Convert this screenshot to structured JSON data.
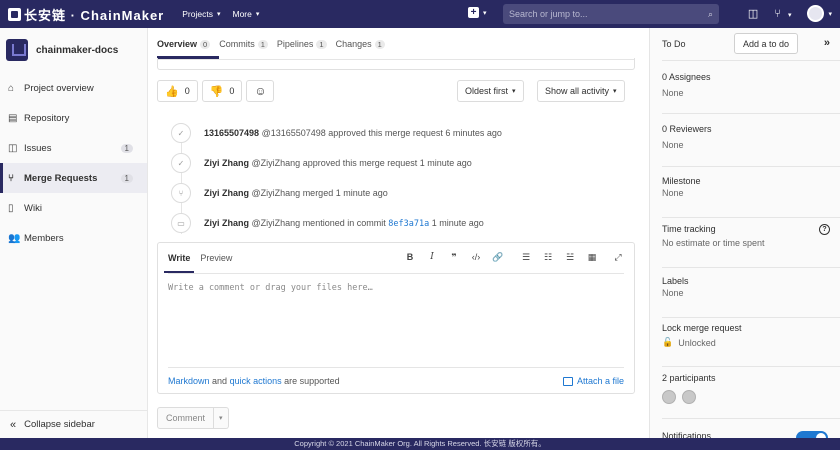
{
  "topbar": {
    "logo_text": "长安链 · ChainMaker",
    "nav": [
      "Projects",
      "More"
    ],
    "search_placeholder": "Search or jump to..."
  },
  "sidebar": {
    "project_name": "chainmaker-docs",
    "items": [
      {
        "label": "Project overview",
        "icon": "home-icon"
      },
      {
        "label": "Repository",
        "icon": "book-icon"
      },
      {
        "label": "Issues",
        "icon": "issues-icon",
        "count": "1"
      },
      {
        "label": "Merge Requests",
        "icon": "merge-request-icon",
        "count": "1"
      },
      {
        "label": "Wiki",
        "icon": "wiki-icon"
      },
      {
        "label": "Members",
        "icon": "users-icon"
      }
    ],
    "collapse_label": "Collapse sidebar"
  },
  "tabs": [
    {
      "label": "Overview",
      "count": "0"
    },
    {
      "label": "Commits",
      "count": "1"
    },
    {
      "label": "Pipelines",
      "count": "1"
    },
    {
      "label": "Changes",
      "count": "1"
    }
  ],
  "reactions": {
    "thumbs_up": "0",
    "thumbs_down": "0"
  },
  "filters": {
    "sort": "Oldest first",
    "activity": "Show all activity"
  },
  "timeline": [
    {
      "author": "13165507498",
      "handle": "@13165507498",
      "text": "approved this merge request 6 minutes ago"
    },
    {
      "author": "Ziyi Zhang",
      "handle": "@ZiyiZhang",
      "text": "approved this merge request 1 minute ago"
    },
    {
      "author": "Ziyi Zhang",
      "handle": "@ZiyiZhang",
      "text": "merged 1 minute ago"
    },
    {
      "author": "Ziyi Zhang",
      "handle": "@ZiyiZhang",
      "text": "mentioned in commit",
      "commit": "8ef3a71a",
      "time": "1 minute ago"
    }
  ],
  "editor": {
    "write_tab": "Write",
    "preview_tab": "Preview",
    "placeholder": "Write a comment or drag your files here…",
    "markdown_link": "Markdown",
    "and_text": "and",
    "quick_actions_link": "quick actions",
    "supported_text": "are supported",
    "attach_label": "Attach a file"
  },
  "comment_button": "Comment",
  "right_sidebar": {
    "todo_label": "To Do",
    "add_todo": "Add a to do",
    "assignees_title": "0 Assignees",
    "assignees_value": "None",
    "reviewers_title": "0 Reviewers",
    "reviewers_value": "None",
    "milestone_title": "Milestone",
    "milestone_value": "None",
    "time_title": "Time tracking",
    "time_value": "No estimate or time spent",
    "labels_title": "Labels",
    "labels_value": "None",
    "lock_title": "Lock merge request",
    "lock_value": "Unlocked",
    "participants_title": "2 participants",
    "notifications_title": "Notifications"
  },
  "footer": "Copyright © 2021 ChainMaker Org. All Rights Reserved. 长安链 版权所有。"
}
